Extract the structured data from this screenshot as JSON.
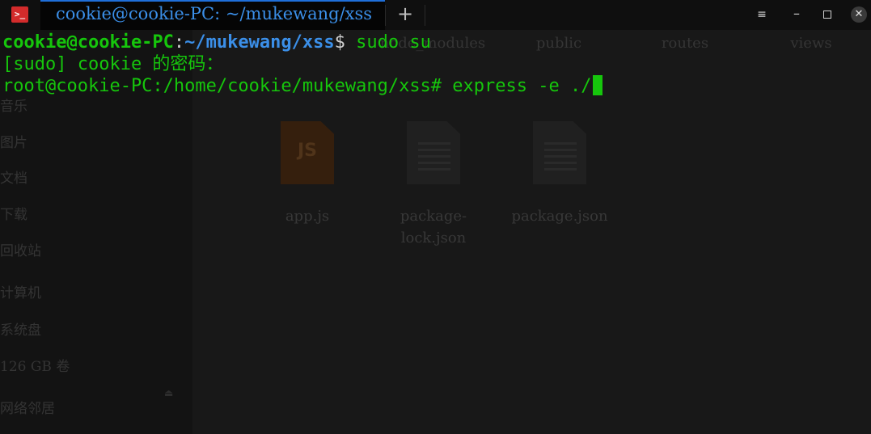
{
  "window": {
    "tab_title": "cookie@cookie-PC: ~/mukewang/xss",
    "add_tab": "+",
    "menu_glyph": "≡",
    "minimize_glyph": "–",
    "close_glyph": "✕",
    "app_icon_glyph": ">_"
  },
  "terminal": {
    "line1": {
      "user_host": "cookie@cookie-PC",
      "colon": ":",
      "path": "~/mukewang/xss",
      "prompt": "$",
      "command": " sudo su"
    },
    "line2": "[sudo] cookie 的密码：",
    "line3": {
      "prompt": "root@cookie-PC:/home/cookie/mukewang/xss#",
      "command": " express -e ./"
    }
  },
  "file_manager": {
    "sidebar": [
      "音乐",
      "图片",
      "文档",
      "下载",
      "回收站",
      "计算机",
      "系统盘",
      "126 GB 卷",
      "网络邻居"
    ],
    "eject_glyph": "⏏",
    "folders": [
      "node_modules",
      "public",
      "routes",
      "views"
    ],
    "files": [
      {
        "name": "app.js",
        "icon": "js-file-icon",
        "badge": "JS"
      },
      {
        "name": "package-lock.json",
        "icon": "document-icon"
      },
      {
        "name": "package.json",
        "icon": "document-icon"
      }
    ]
  },
  "colors": {
    "green": "#16c60c",
    "blue": "#3b8fe8",
    "accent": "#1f6fd9",
    "close_red": "#d32b2b"
  }
}
